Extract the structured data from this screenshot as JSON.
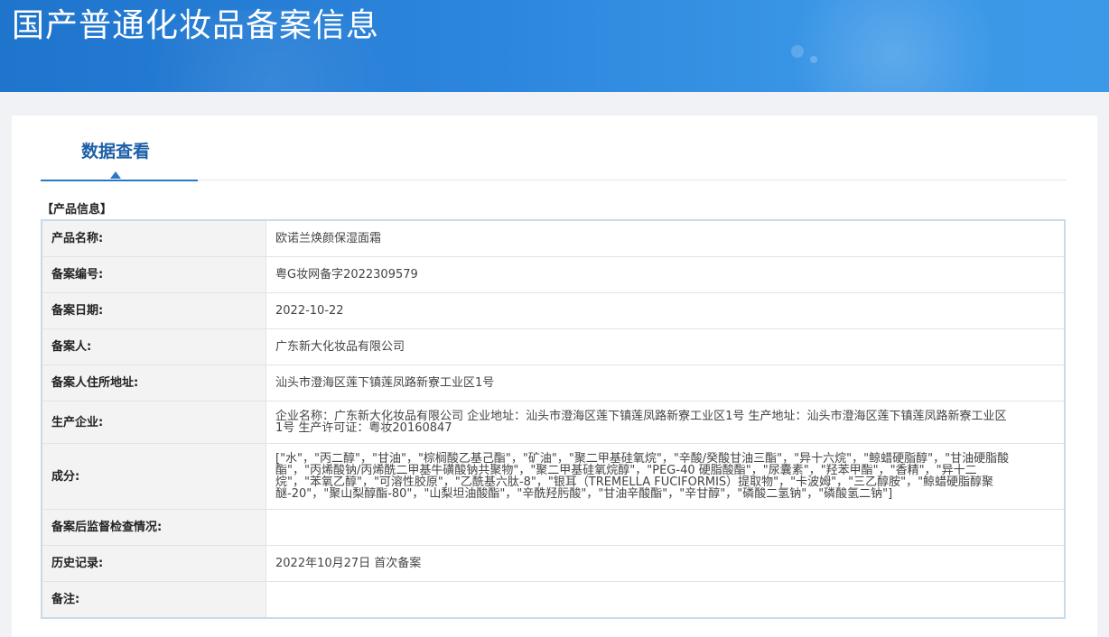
{
  "header": {
    "title": "国产普通化妆品备案信息"
  },
  "tabs": [
    {
      "label": "数据查看"
    }
  ],
  "section": {
    "title": "【产品信息】"
  },
  "rows": [
    {
      "label": "产品名称:",
      "value": "欧诺兰焕颜保湿面霜"
    },
    {
      "label": "备案编号:",
      "value": "粤G妆网备字2022309579"
    },
    {
      "label": "备案日期:",
      "value": "2022-10-22"
    },
    {
      "label": "备案人:",
      "value": "广东新大化妆品有限公司"
    },
    {
      "label": "备案人住所地址:",
      "value": "汕头市澄海区莲下镇莲凤路新寮工业区1号"
    },
    {
      "label": "生产企业:",
      "value": "企业名称：广东新大化妆品有限公司 企业地址：汕头市澄海区莲下镇莲凤路新寮工业区1号 生产地址：汕头市澄海区莲下镇莲凤路新寮工业区1号 生产许可证：粤妆20160847"
    },
    {
      "label": "成分:",
      "value": "[\"水\"，\"丙二醇\"，\"甘油\"，\"棕榈酸乙基己酯\"，\"矿油\"，\"聚二甲基硅氧烷\"，\"辛酸/癸酸甘油三酯\"，\"异十六烷\"，\"鲸蜡硬脂醇\"，\"甘油硬脂酸酯\"，\"丙烯酸钠/丙烯酰二甲基牛磺酸钠共聚物\"，\"聚二甲基硅氧烷醇\"，\"PEG-40 硬脂酸酯\"，\"尿囊素\"，\"羟苯甲酯\"，\"香精\"，\"异十二烷\"，\"苯氧乙醇\"，\"可溶性胶原\"，\"乙酰基六肽-8\"，\"银耳（TREMELLA FUCIFORMIS）提取物\"，\"卡波姆\"，\"三乙醇胺\"，\"鲸蜡硬脂醇聚醚-20\"，\"聚山梨醇酯-80\"，\"山梨坦油酸酯\"，\"辛酰羟肟酸\"，\"甘油辛酸酯\"，\"辛甘醇\"，\"磷酸二氢钠\"，\"磷酸氢二钠\"]"
    },
    {
      "label": "备案后监督检查情况:",
      "value": ""
    },
    {
      "label": "历史记录:",
      "value": "2022年10月27日 首次备案"
    },
    {
      "label": "备注:",
      "value": ""
    }
  ]
}
